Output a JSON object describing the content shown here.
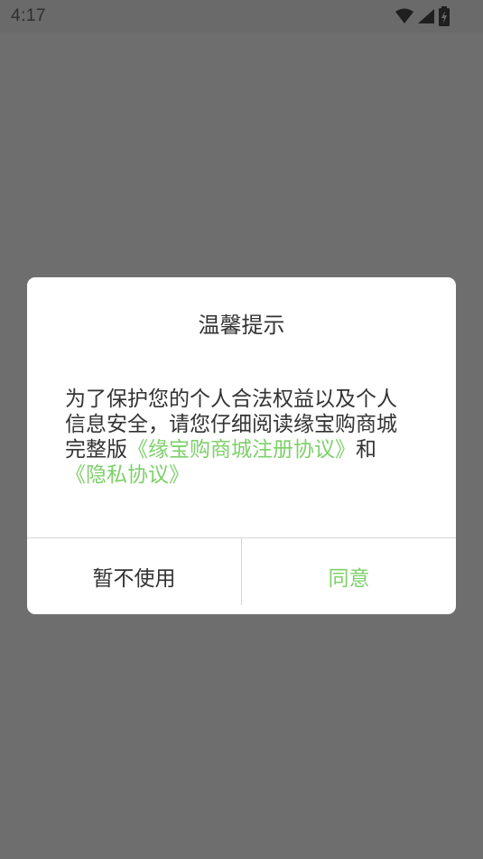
{
  "status_bar": {
    "time": "4:17",
    "icons": [
      "wifi-icon",
      "signal-icon",
      "battery-charging-icon"
    ]
  },
  "dialog": {
    "title": "温馨提示",
    "body_text": "为了保护您的个人合法权益以及个人信息安全，请您仔细阅读缘宝购商城完整版",
    "link_register": "《缘宝购商城注册协议》",
    "and_text": "和",
    "link_privacy": "《隐私协议》",
    "cancel_label": "暂不使用",
    "agree_label": "同意"
  },
  "colors": {
    "overlay": "#6e6e6e",
    "dialog_bg": "#ffffff",
    "accent": "#7ed06b",
    "text": "#333333",
    "divider": "#d6d6d6"
  }
}
